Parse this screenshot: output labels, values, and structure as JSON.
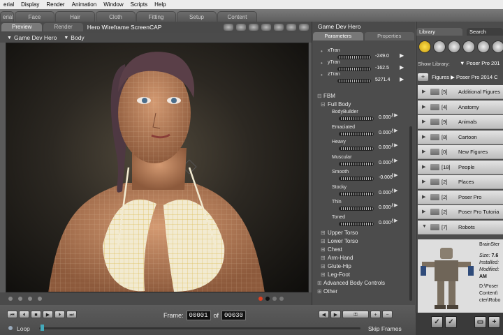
{
  "menu": [
    "erial",
    "Display",
    "Render",
    "Animation",
    "Window",
    "Scripts",
    "Help"
  ],
  "rooms": [
    "erial",
    "Face",
    "Hair",
    "Cloth",
    "Fitting",
    "Setup",
    "Content"
  ],
  "doc": {
    "tabs": [
      "Preview",
      "Render"
    ],
    "camera_label": "Hero  Wireframe  ScreenCAP"
  },
  "selection": {
    "figure": "Game Dev Hero",
    "actor": "Body"
  },
  "params": {
    "title": "Game Dev Hero",
    "tabs": [
      "Parameters",
      "Properties"
    ],
    "trans": [
      {
        "label": "xTran",
        "value": "-249.0"
      },
      {
        "label": "yTran",
        "value": "-162.5"
      },
      {
        "label": "zTran",
        "value": "5271.4"
      }
    ],
    "group": "FBM",
    "subgroup": "Full Body",
    "morphs": [
      {
        "label": "BodyBuilder",
        "value": "0.000"
      },
      {
        "label": "Emaciated",
        "value": "0.000"
      },
      {
        "label": "Heavy",
        "value": "0.000"
      },
      {
        "label": "Muscular",
        "value": "0.000"
      },
      {
        "label": "Smooth",
        "value": "-0.000"
      },
      {
        "label": "Stocky",
        "value": "0.000"
      },
      {
        "label": "Thin",
        "value": "0.000"
      },
      {
        "label": "Toned",
        "value": "0.000"
      }
    ],
    "groups": [
      "Upper Torso",
      "Lower Torso",
      "Chest",
      "Arm-Hand",
      "Glute-Hip",
      "Leg-Foot"
    ],
    "advanced": "Advanced Body Controls",
    "other": "Other"
  },
  "animation": {
    "frame_label": "Frame:",
    "frame": "00001",
    "of_label": "of",
    "total": "00030",
    "loop_label": "Loop",
    "skip_label": "Skip Frames"
  },
  "library": {
    "tabs": [
      "Library",
      "Search"
    ],
    "show_label": "Show Library:",
    "show_value": "Poser Pro 201",
    "breadcrumb": "Figures ▶ Poser Pro 2014 C",
    "rows": [
      {
        "count": "[5]",
        "name": "Additional Figures"
      },
      {
        "count": "[4]",
        "name": "Anatomy"
      },
      {
        "count": "[9]",
        "name": "Animals"
      },
      {
        "count": "[8]",
        "name": "Cartoon"
      },
      {
        "count": "[0]",
        "name": "New Figures"
      },
      {
        "count": "[18]",
        "name": "People"
      },
      {
        "count": "[2]",
        "name": "Places"
      },
      {
        "count": "[2]",
        "name": "Poser Pro"
      },
      {
        "count": "[2]",
        "name": "Poser Pro Tutoria"
      },
      {
        "count": "[7]",
        "name": "Robots"
      }
    ],
    "preview": {
      "name": "BrainSter",
      "size_label": "Size:",
      "size": "7.6",
      "installed_label": "Installed:",
      "modified_label": "Modified:",
      "ampm": "AM",
      "path": [
        "D:\\Poser",
        "Content\\",
        "cter\\Robo"
      ]
    }
  }
}
